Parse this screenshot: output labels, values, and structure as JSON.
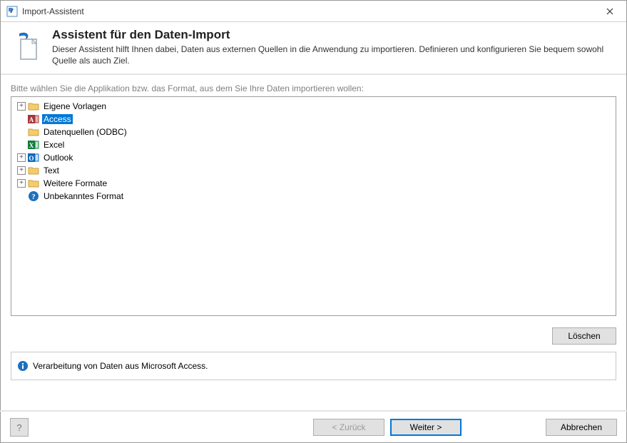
{
  "window": {
    "title": "Import-Assistent"
  },
  "header": {
    "title": "Assistent für den Daten-Import",
    "subtitle": "Dieser Assistent hilft Ihnen dabei, Daten aus externen Quellen in die Anwendung zu importieren. Definieren und konfigurieren Sie bequem sowohl Quelle als auch Ziel."
  },
  "instruction": "Bitte wählen Sie die Applikation bzw. das Format, aus dem Sie Ihre Daten importieren wollen:",
  "tree": {
    "items": [
      {
        "label": "Eigene Vorlagen",
        "icon": "folder",
        "expandable": true,
        "selected": false
      },
      {
        "label": "Access",
        "icon": "access",
        "expandable": false,
        "selected": true
      },
      {
        "label": "Datenquellen (ODBC)",
        "icon": "folder",
        "expandable": false,
        "selected": false
      },
      {
        "label": "Excel",
        "icon": "excel",
        "expandable": false,
        "selected": false
      },
      {
        "label": "Outlook",
        "icon": "outlook",
        "expandable": true,
        "selected": false
      },
      {
        "label": "Text",
        "icon": "folder",
        "expandable": true,
        "selected": false
      },
      {
        "label": "Weitere Formate",
        "icon": "folder",
        "expandable": true,
        "selected": false
      },
      {
        "label": "Unbekanntes Format",
        "icon": "help",
        "expandable": false,
        "selected": false
      }
    ]
  },
  "buttons": {
    "delete": "Löschen",
    "back": "< Zurück",
    "next": "Weiter >",
    "cancel": "Abbrechen",
    "help": "?"
  },
  "info": {
    "text": "Verarbeitung von Daten aus Microsoft Access."
  }
}
